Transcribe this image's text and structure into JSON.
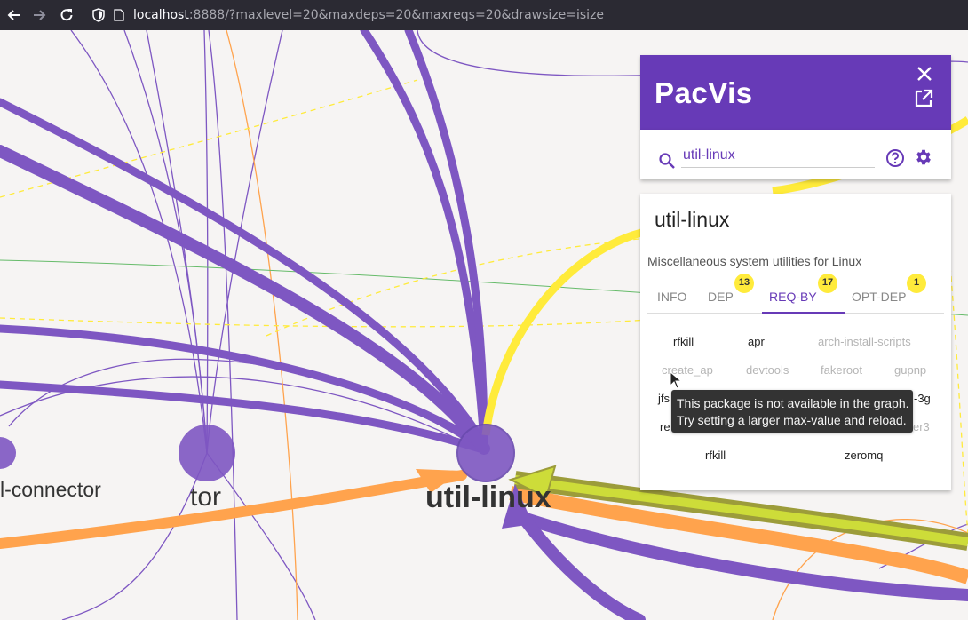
{
  "browser": {
    "url_host": "localhost",
    "url_rest": ":8888/?maxlevel=20&maxdeps=20&maxreqs=20&drawsize=isize"
  },
  "graph": {
    "nodes": [
      {
        "label": "l-connector"
      },
      {
        "label": "tor"
      },
      {
        "label": "util-linux"
      }
    ],
    "colors": {
      "node": "#7e57c2",
      "dep_edge": "#7e57c2",
      "req_edge": "#ffa34d",
      "highlight": "#ffeb3b",
      "optional_edge": "#66bb6a"
    }
  },
  "panel": {
    "title": "PacVis",
    "close_icon": "close-icon",
    "open_external_icon": "open-in-new-icon",
    "search_value": "util-linux",
    "search_icon": "search-icon",
    "help_icon": "help-icon",
    "settings_icon": "gear-icon",
    "accent": "#673ab7"
  },
  "info": {
    "name": "util-linux",
    "description": "Miscellaneous system utilities for Linux",
    "tabs": [
      {
        "label": "INFO",
        "badge": ""
      },
      {
        "label": "DEP",
        "badge": "13"
      },
      {
        "label": "REQ-BY",
        "badge": "17"
      },
      {
        "label": "OPT-DEP",
        "badge": "1"
      }
    ],
    "active_tab": "REQ-BY",
    "req_by": [
      {
        "name": "rfkill",
        "available": true
      },
      {
        "name": "apr",
        "available": true
      },
      {
        "name": "arch-install-scripts",
        "available": false
      },
      {
        "name": "create_ap",
        "available": false
      },
      {
        "name": "devtools",
        "available": false
      },
      {
        "name": "fakeroot",
        "available": false
      },
      {
        "name": "gupnp",
        "available": false
      },
      {
        "name": "jfs",
        "available": true
      },
      {
        "name": "-3g",
        "available": true
      },
      {
        "name": "re",
        "available": true
      },
      {
        "name": "er3",
        "available": false
      },
      {
        "name": "rfkill",
        "available": true
      },
      {
        "name": "zeromq",
        "available": true
      }
    ]
  },
  "tooltip": {
    "line1": "This package is not available in the graph.",
    "line2": "Try setting a larger max-value and reload."
  }
}
